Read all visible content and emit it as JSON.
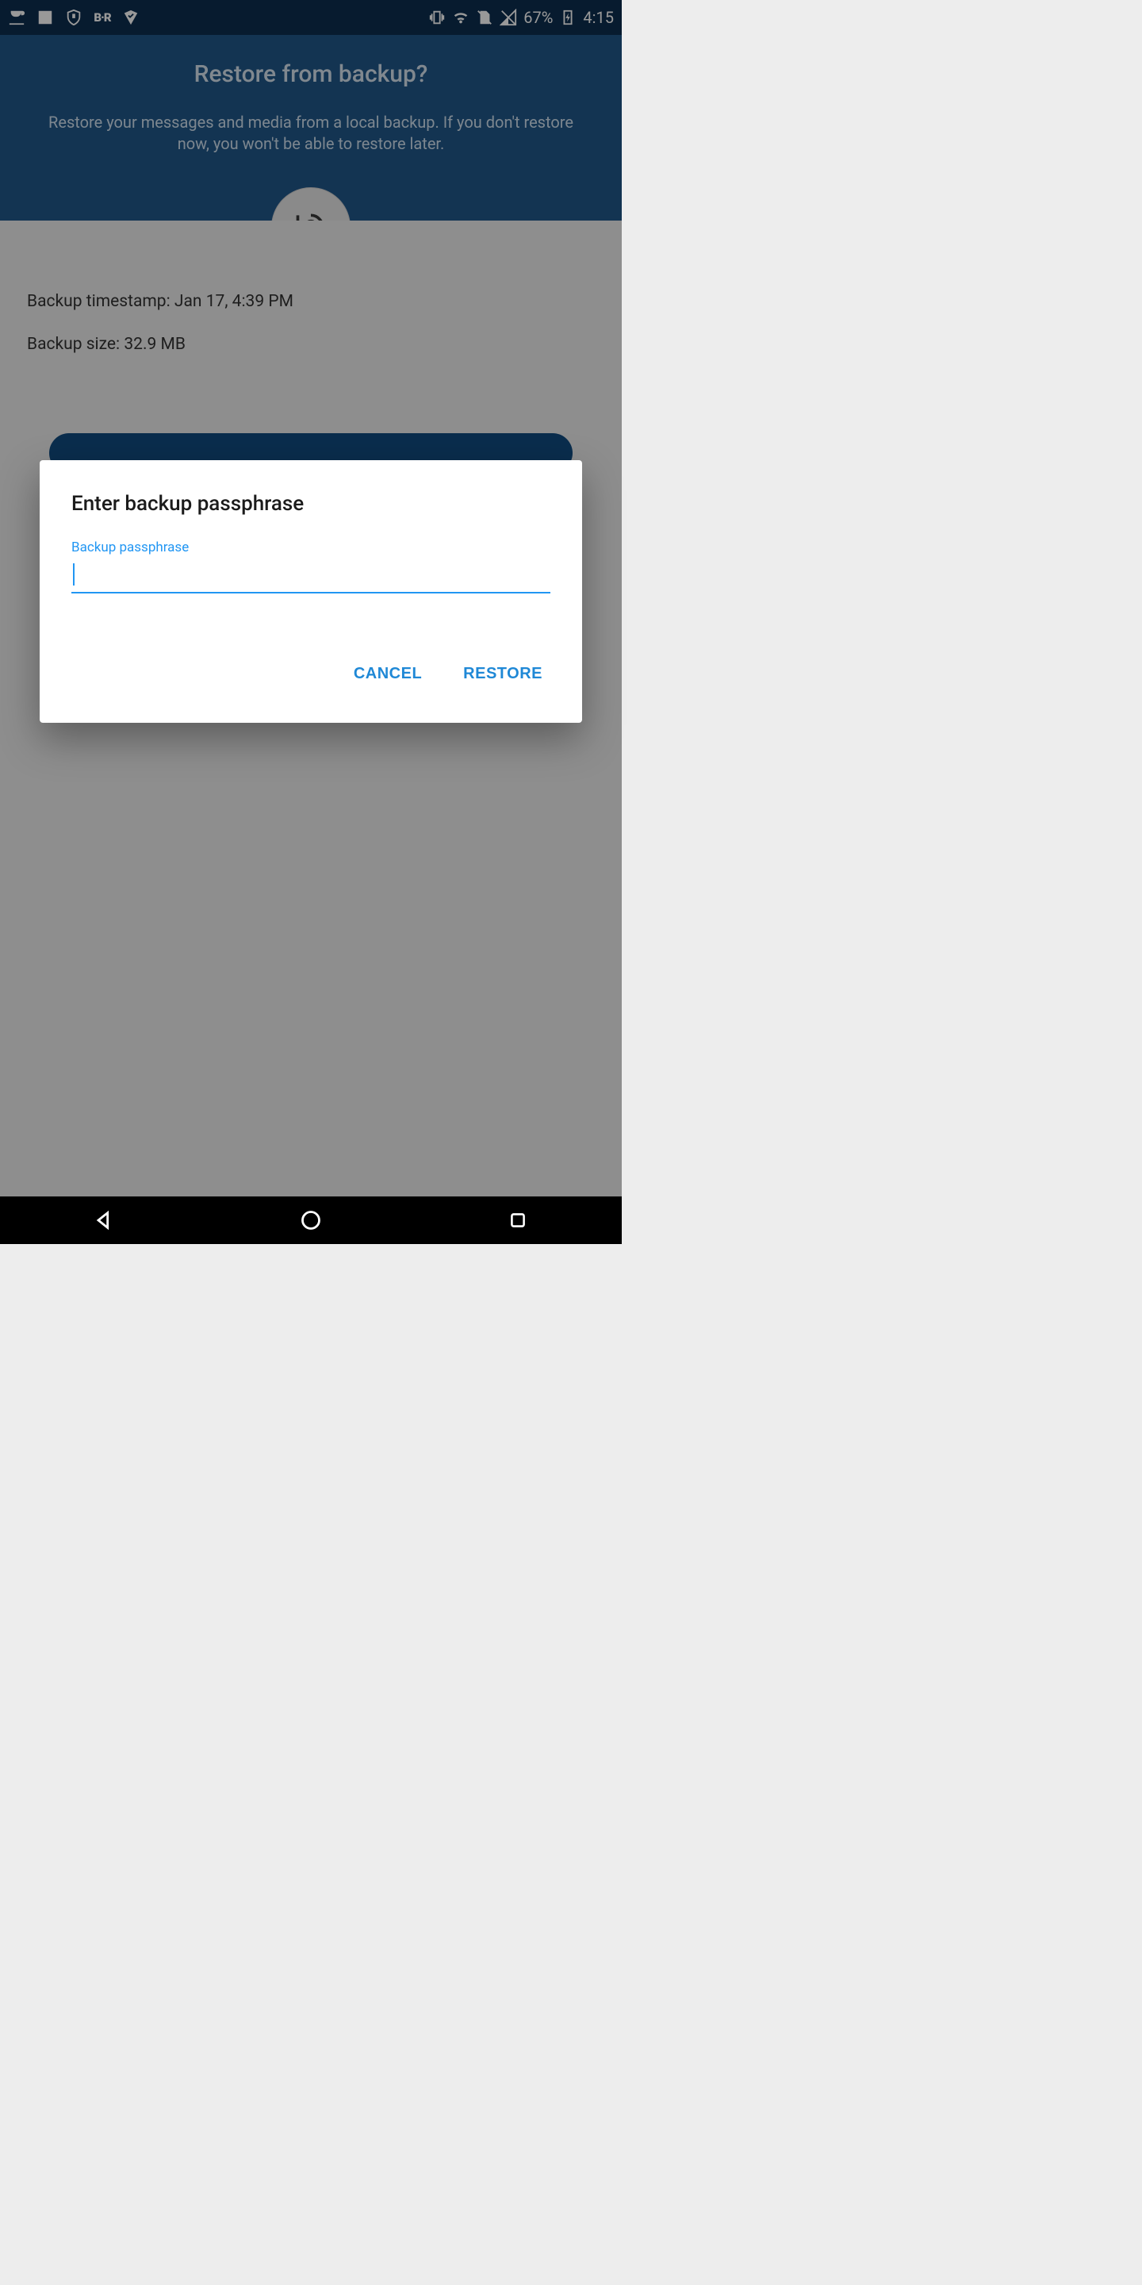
{
  "status": {
    "battery": "67%",
    "time": "4:15"
  },
  "header": {
    "title": "Restore from backup?",
    "subtitle": "Restore your messages and media from a local backup. If you don't restore now, you won't be able to restore later."
  },
  "backup": {
    "timestamp_label": "Backup timestamp:",
    "timestamp_value": "Jan 17, 4:39 PM",
    "size_label": "Backup size:",
    "size_value": "32.9 MB"
  },
  "dialog": {
    "title": "Enter backup passphrase",
    "field_label": "Backup passphrase",
    "field_value": "",
    "cancel": "CANCEL",
    "restore": "RESTORE"
  }
}
